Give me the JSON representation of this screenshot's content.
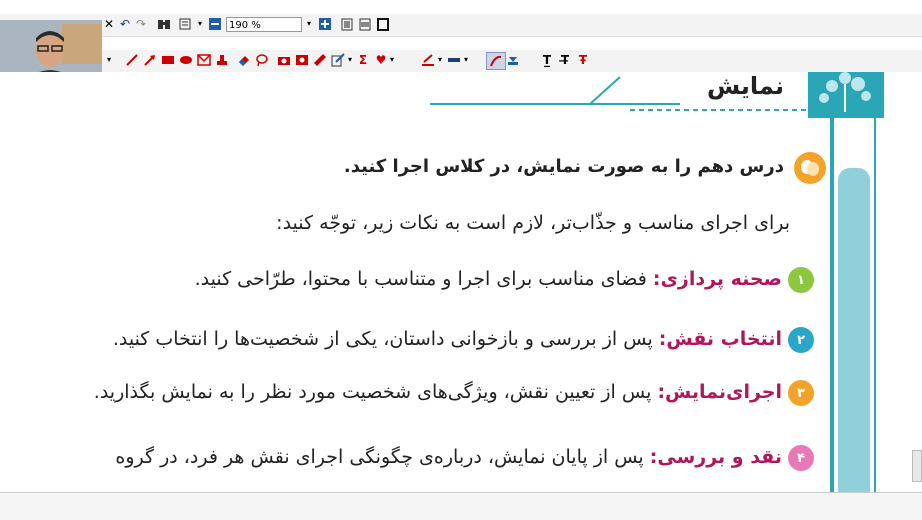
{
  "toolbar": {
    "zoom_value": "190 %"
  },
  "page": {
    "section_title": "نمایش",
    "intro_heading": "درس دهم را به صورت نمایش، در کلاس اجرا کنید.",
    "intro_text": "برای اجرای مناسب و جذّاب‌تر، لازم است به نکات زیر، توجّه کنید:",
    "items": [
      {
        "number": "۱",
        "term": "صحنه پردازی:",
        "text": "فضای مناسب برای اجرا و متناسب با محتوا، طرّاحی کنید.",
        "color": "#8dc63f"
      },
      {
        "number": "۲",
        "term": "انتخاب نقش:",
        "text": "پس از بررسی و بازخوانی داستان، یکی از شخصیت‌ها را انتخاب کنید.",
        "color": "#2aa6c9"
      },
      {
        "number": "۳",
        "term": "اجرای‌نمایش:",
        "text": "پس از تعیین نقش، ویژگی‌های شخصیت مورد نظر را به نمایش بگذارید.",
        "color": "#f3a32a"
      },
      {
        "number": "۴",
        "term": "نقد و بررسی:",
        "text": "پس از پایان نمایش، درباره‌ی چگونگی اجرای نقش هر فرد، در گروه",
        "color": "#e879b7"
      }
    ]
  },
  "icons": [
    "undo-icon",
    "redo-icon",
    "binoculars-icon",
    "page-view-icon",
    "zoom-out-icon",
    "zoom-in-icon",
    "fit-page-icon",
    "fit-width-icon",
    "full-screen-icon",
    "pen-icon",
    "arrow-icon",
    "rectangle-icon",
    "ellipse-icon",
    "envelope-icon",
    "stamp-icon",
    "eraser-icon",
    "lasso-icon",
    "camera-icon",
    "image-icon",
    "ruler-icon",
    "edit-icon",
    "sigma-icon",
    "heart-icon",
    "line-color-icon",
    "line-width-icon",
    "highlighter-icon",
    "text-icon"
  ]
}
